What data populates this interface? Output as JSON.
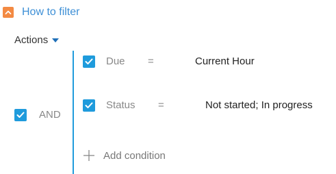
{
  "colors": {
    "accent": "#1f9bdc",
    "toggle": "#f38a43",
    "title": "#3d8fd6"
  },
  "header": {
    "title": "How to filter",
    "toggle_icon": "chevron-up-icon"
  },
  "actions": {
    "label": "Actions",
    "icon": "caret-down-icon"
  },
  "group": {
    "logic": "AND",
    "checked": true
  },
  "conditions": [
    {
      "checked": true,
      "field": "Due",
      "operator": "=",
      "value": "Current Hour"
    },
    {
      "checked": true,
      "field": "Status",
      "operator": "=",
      "value": "Not started; In progress"
    }
  ],
  "add_condition": {
    "label": "Add condition",
    "icon": "plus-icon"
  }
}
